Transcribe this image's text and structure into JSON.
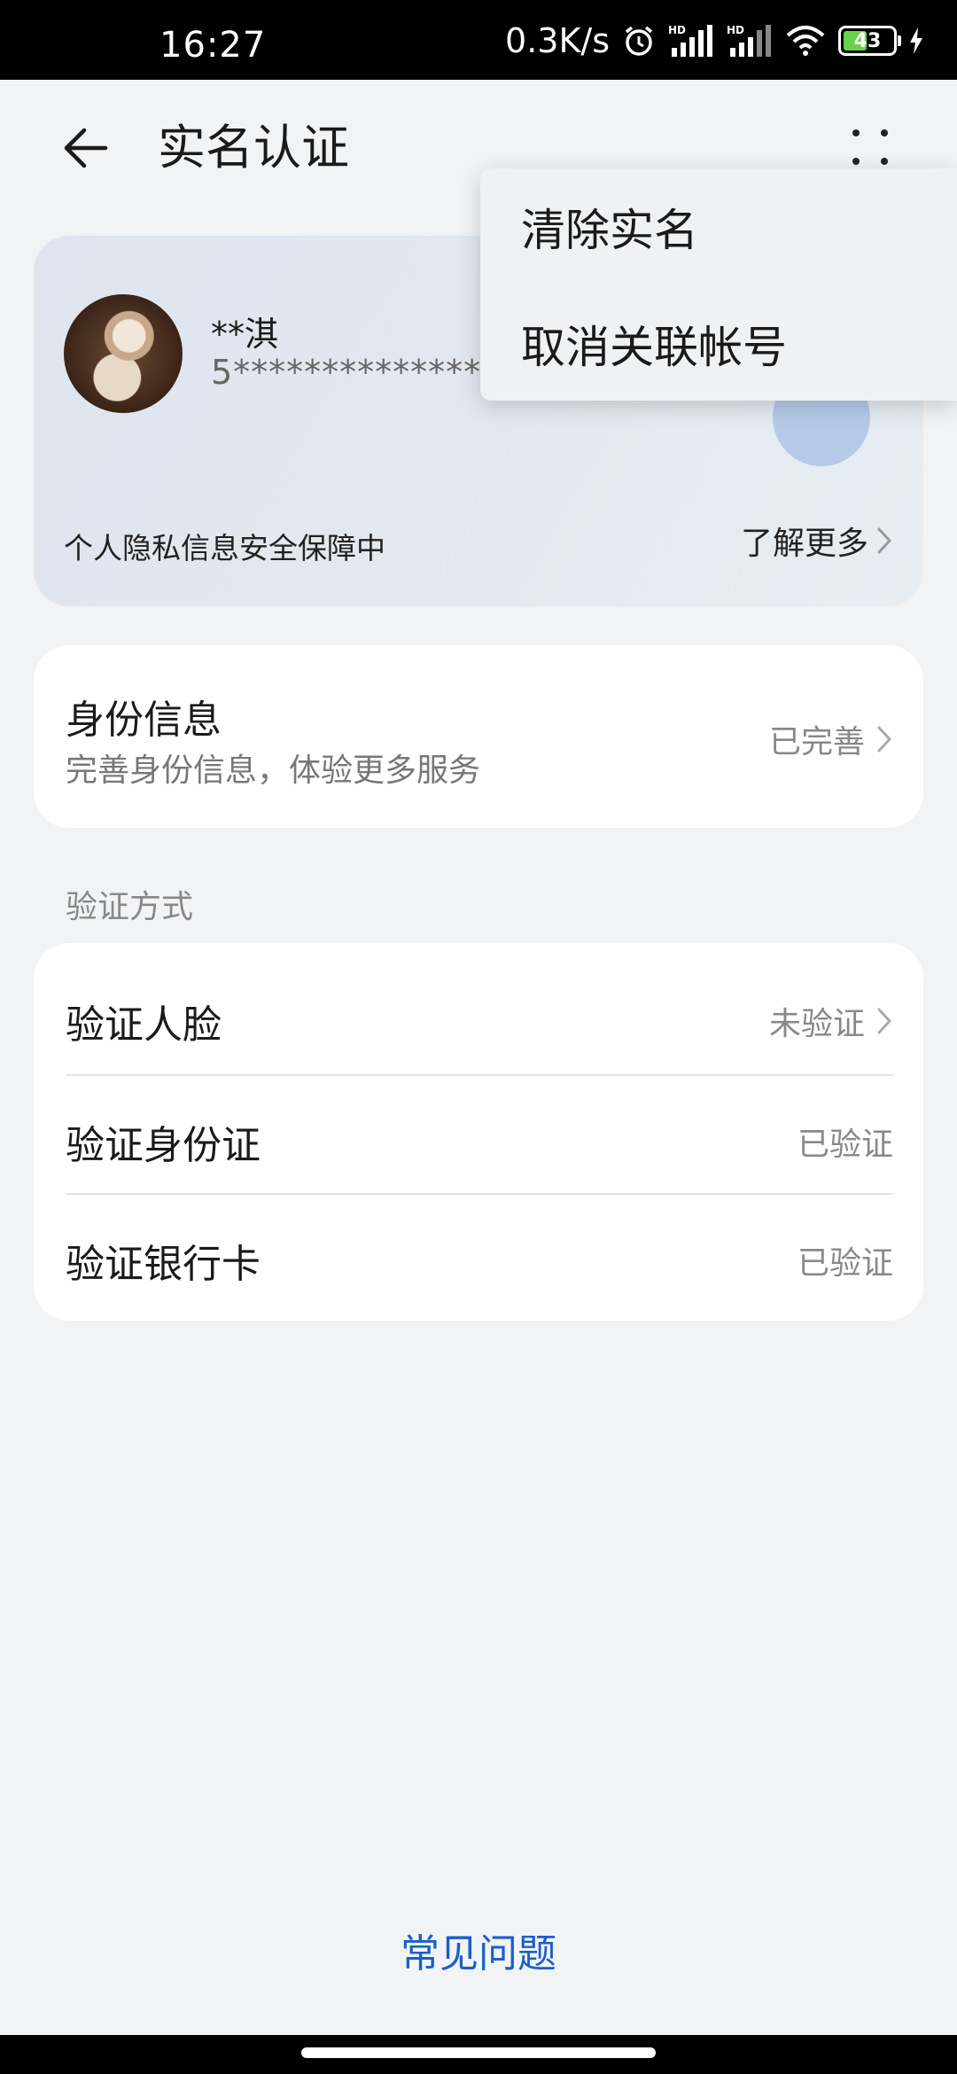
{
  "status_bar": {
    "time": "16:27",
    "net_speed": "0.3K/s",
    "battery": "43",
    "icons": [
      "alarm-icon",
      "hd-signal-icon",
      "hd-signal-icon",
      "wifi-icon",
      "battery-icon",
      "charging-icon"
    ]
  },
  "header": {
    "title": "实名认证",
    "back_icon": "back-arrow-icon",
    "more_icon": "more-dots-icon"
  },
  "identity_card": {
    "name": "**淇",
    "id_number": "5****************8",
    "privacy_text": "个人隐私信息安全保障中",
    "learn_more": "了解更多"
  },
  "identity_info": {
    "title": "身份信息",
    "subtitle": "完善身份信息，体验更多服务",
    "status": "已完善"
  },
  "verify_section": {
    "label": "验证方式",
    "rows": [
      {
        "label": "验证人脸",
        "status": "未验证"
      },
      {
        "label": "验证身份证",
        "status": "已验证"
      },
      {
        "label": "验证银行卡",
        "status": "已验证"
      }
    ]
  },
  "popup_menu": {
    "items": [
      {
        "label": "清除实名"
      },
      {
        "label": "取消关联帐号"
      }
    ]
  },
  "footer": {
    "faq": "常见问题"
  },
  "colors": {
    "background": "#f1f3f5",
    "card": "#ffffff",
    "link": "#1a5fc9",
    "battery_fill": "#6ad14f"
  }
}
